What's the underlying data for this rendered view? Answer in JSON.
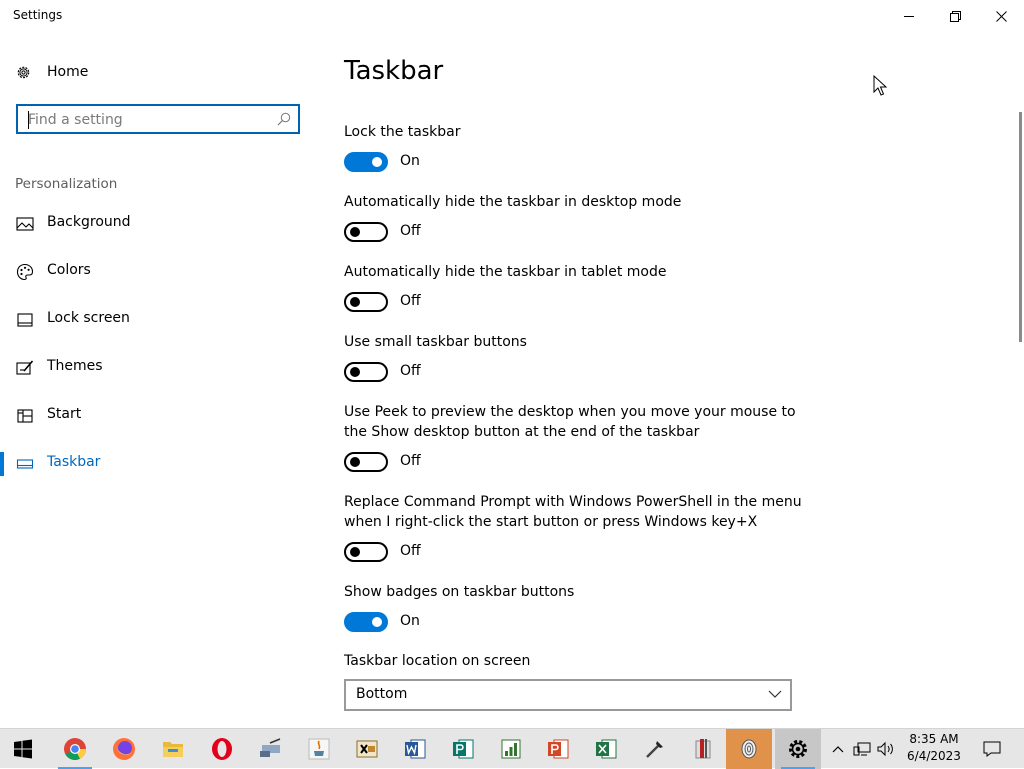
{
  "window": {
    "title": "Settings",
    "minimize_icon": "minimize-icon",
    "restore_icon": "restore-icon",
    "close_icon": "close-icon"
  },
  "sidebar": {
    "home_label": "Home",
    "search": {
      "placeholder": "Find a setting",
      "value": ""
    },
    "section_label": "Personalization",
    "items": [
      {
        "label": "Background",
        "icon": "picture-icon",
        "active": false
      },
      {
        "label": "Colors",
        "icon": "palette-icon",
        "active": false
      },
      {
        "label": "Lock screen",
        "icon": "lock-screen-icon",
        "active": false
      },
      {
        "label": "Themes",
        "icon": "themes-icon",
        "active": false
      },
      {
        "label": "Start",
        "icon": "start-grid-icon",
        "active": false
      },
      {
        "label": "Taskbar",
        "icon": "taskbar-icon",
        "active": true
      }
    ]
  },
  "main": {
    "title": "Taskbar",
    "settings": [
      {
        "label": "Lock the taskbar",
        "state": "On"
      },
      {
        "label": "Automatically hide the taskbar in desktop mode",
        "state": "Off"
      },
      {
        "label": "Automatically hide the taskbar in tablet mode",
        "state": "Off"
      },
      {
        "label": "Use small taskbar buttons",
        "state": "Off"
      },
      {
        "label": "Use Peek to preview the desktop when you move your mouse to the Show desktop button at the end of the taskbar",
        "state": "Off"
      },
      {
        "label": "Replace Command Prompt with Windows PowerShell in the menu when I right-click the start button or press Windows key+X",
        "state": "Off"
      },
      {
        "label": "Show badges on taskbar buttons",
        "state": "On"
      }
    ],
    "location_label": "Taskbar location on screen",
    "location_value": "Bottom"
  },
  "taskbar": {
    "apps": [
      "windows-start-icon",
      "chrome-icon",
      "firefox-icon",
      "file-explorer-icon",
      "opera-icon",
      "network-app-icon",
      "java-icon",
      "xml-editor-icon",
      "word-icon",
      "publisher-icon",
      "project-icon",
      "powerpoint-icon",
      "excel-icon",
      "tool-icon",
      "archive-icon",
      "fingerprint-app-icon",
      "settings-gear-icon"
    ],
    "tray": [
      "chevron-up-icon",
      "network-icon",
      "volume-icon",
      "notification-icon"
    ],
    "time": "8:35 AM",
    "date": "6/4/2023"
  },
  "colors": {
    "accent": "#0078d7",
    "taskbar": "#e6e6e6"
  }
}
